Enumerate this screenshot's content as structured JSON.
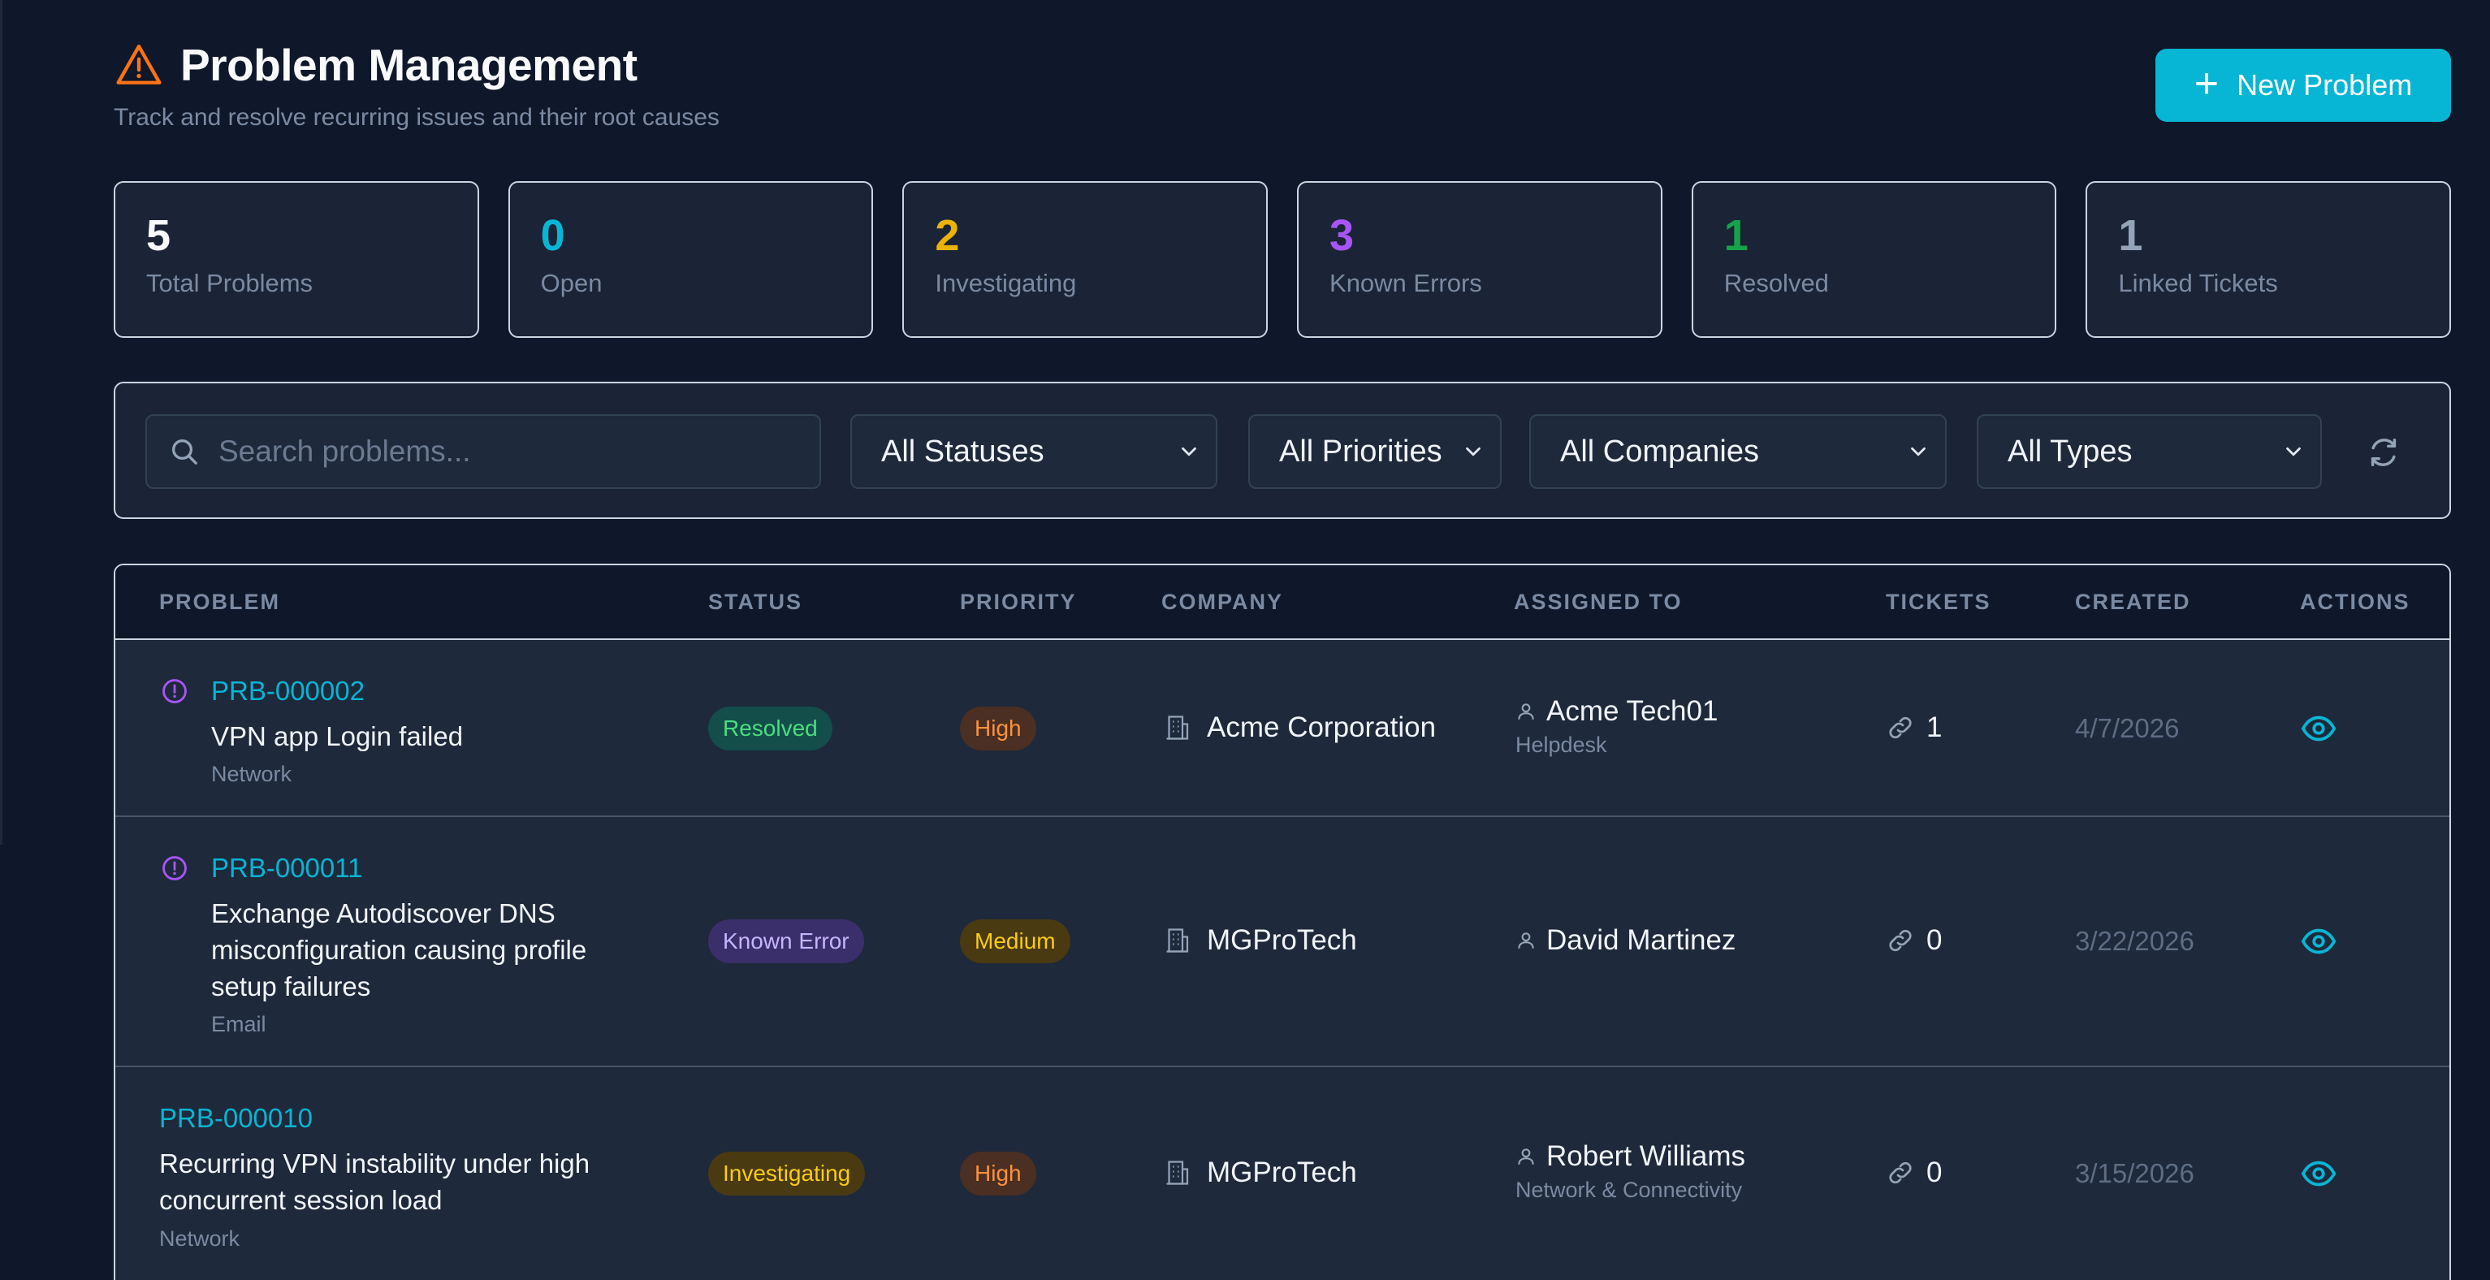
{
  "header": {
    "title": "Problem Management",
    "subtitle": "Track and resolve recurring issues and their root causes",
    "new_button_label": "New Problem",
    "title_icon": "warning-triangle-icon"
  },
  "stats": [
    {
      "value": "5",
      "label": "Total Problems",
      "color": "#f8fafc"
    },
    {
      "value": "0",
      "label": "Open",
      "color": "#06b6d4"
    },
    {
      "value": "2",
      "label": "Investigating",
      "color": "#eab308"
    },
    {
      "value": "3",
      "label": "Known Errors",
      "color": "#a855f7"
    },
    {
      "value": "1",
      "label": "Resolved",
      "color": "#16a34a"
    },
    {
      "value": "1",
      "label": "Linked Tickets",
      "color": "#94a3b8"
    }
  ],
  "filters": {
    "search_placeholder": "Search problems...",
    "status": "All Statuses",
    "priority": "All Priorities",
    "company": "All Companies",
    "type": "All Types"
  },
  "table": {
    "headers": {
      "problem": "PROBLEM",
      "status": "STATUS",
      "priority": "PRIORITY",
      "company": "COMPANY",
      "assigned": "ASSIGNED TO",
      "tickets": "TICKETS",
      "created": "CREATED",
      "actions": "ACTIONS"
    },
    "rows": [
      {
        "id": "PRB-000002",
        "title": "VPN app Login failed",
        "category": "Network",
        "status": "Resolved",
        "priority": "High",
        "company": "Acme Corporation",
        "assignee": "Acme Tech01",
        "team": "Helpdesk",
        "tickets": "1",
        "created": "4/7/2026"
      },
      {
        "id": "PRB-000011",
        "title": "Exchange Autodiscover DNS misconfiguration causing profile setup failures",
        "category": "Email",
        "status": "Known Error",
        "priority": "Medium",
        "company": "MGProTech",
        "assignee": "David Martinez",
        "team": "",
        "tickets": "0",
        "created": "3/22/2026"
      },
      {
        "id": "PRB-000010",
        "title": "Recurring VPN instability under high concurrent session load",
        "category": "Network",
        "status": "Investigating",
        "priority": "High",
        "company": "MGProTech",
        "assignee": "Robert Williams",
        "team": "Network & Connectivity",
        "tickets": "0",
        "created": "3/15/2026"
      }
    ]
  },
  "colors": {
    "accent": "#06b6d4",
    "warning_icon": "#f97316",
    "known_error_icon": "#a855f7",
    "badge_resolved_bg": "#134e4a",
    "badge_resolved_text": "#4ade80",
    "badge_known_bg": "#3b2f6b",
    "badge_known_text": "#c4b5fd",
    "badge_investigating_bg": "#4a3a12",
    "badge_investigating_text": "#facc15",
    "badge_high_bg": "#4a2f22",
    "badge_high_text": "#fb923c",
    "badge_medium_bg": "#4a3a12",
    "badge_medium_text": "#facc15"
  }
}
